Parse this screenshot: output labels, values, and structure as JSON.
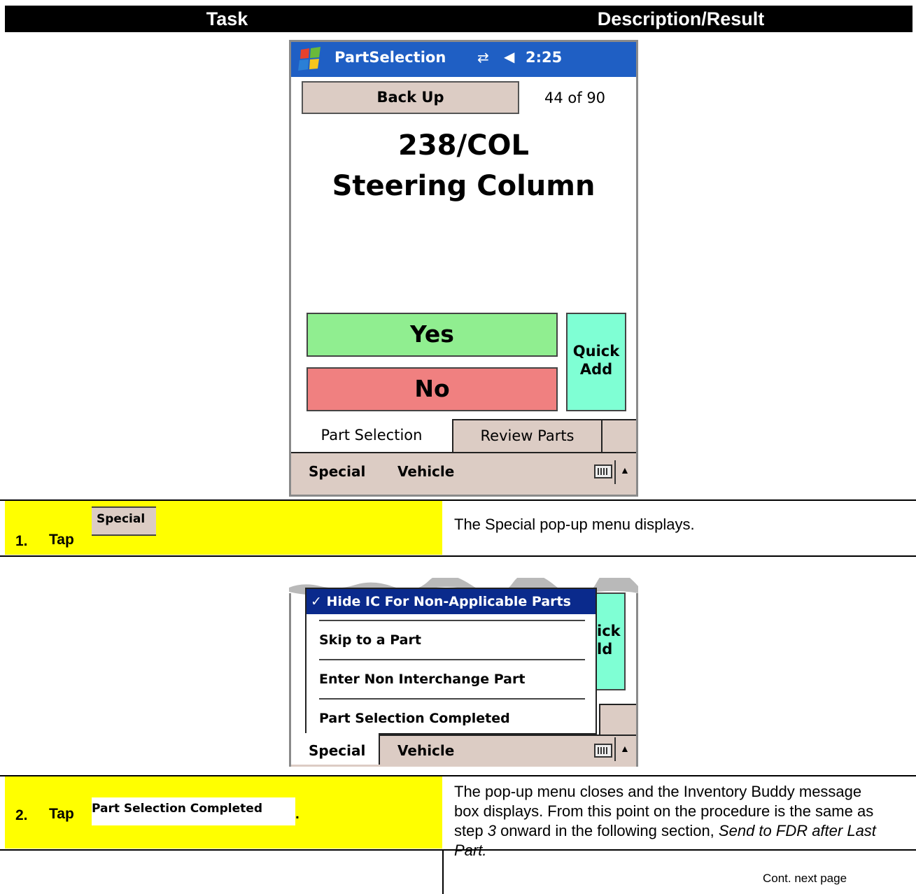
{
  "header": {
    "task": "Task",
    "description": "Description/Result"
  },
  "device1": {
    "app_title": "PartSelection",
    "time": "2:25",
    "back_up_label": "Back Up",
    "counter": "44 of 90",
    "part_code": "238/COL",
    "part_name": "Steering Column",
    "yes_label": "Yes",
    "no_label": "No",
    "quick_add_line1": "Quick",
    "quick_add_line2": "Add",
    "tabs": [
      "Part Selection",
      "Review Parts"
    ],
    "menu": [
      "Special",
      "Vehicle"
    ],
    "colors": {
      "titlebar": "#1f5fc4",
      "yes": "#90ee90",
      "no": "#f08080",
      "quick_add": "#7fffd4",
      "chrome": "#dcccc4"
    }
  },
  "step1": {
    "number": "1.",
    "tap": "Tap",
    "target": "Special",
    "result": "The Special pop-up menu displays."
  },
  "device2": {
    "menu_items": [
      "✓ Hide IC For Non-Applicable Parts",
      "Skip to a Part",
      "Enter Non Interchange Part",
      "Part Selection Completed"
    ],
    "quick_fragment_line1": "ick",
    "quick_fragment_line2": "ld",
    "menu": [
      "Special",
      "Vehicle"
    ]
  },
  "step2": {
    "number": "2.",
    "tap": "Tap",
    "target": "Part Selection Completed",
    "dot": ".",
    "result_part1": "The pop-up menu closes and the Inventory Buddy message box displays.  From this point on the procedure is the same as step ",
    "result_step": "3",
    "result_part2": " onward in the following section,  ",
    "result_section": "Send to FDR after Last Part."
  },
  "footer": {
    "cont": "Cont. next page"
  },
  "colors": {
    "highlight": "#ffff00",
    "header_bg": "#000000"
  }
}
